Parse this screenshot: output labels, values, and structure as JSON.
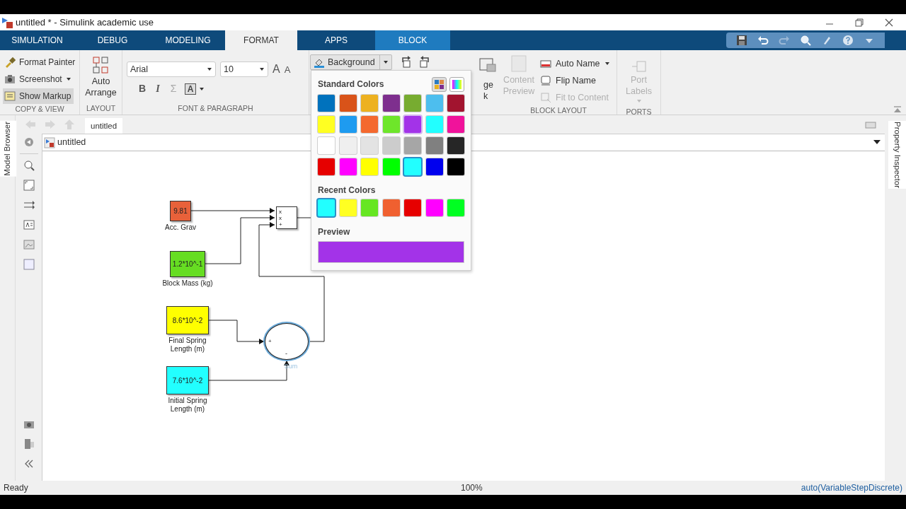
{
  "window": {
    "title": "untitled * - Simulink academic use"
  },
  "tabs": [
    {
      "label": "SIMULATION",
      "selected": false,
      "kind": "main"
    },
    {
      "label": "DEBUG",
      "selected": false,
      "kind": "main"
    },
    {
      "label": "MODELING",
      "selected": false,
      "kind": "main"
    },
    {
      "label": "FORMAT",
      "selected": true,
      "kind": "main"
    },
    {
      "label": "APPS",
      "selected": false,
      "kind": "main"
    },
    {
      "label": "BLOCK",
      "selected": false,
      "kind": "contextual"
    }
  ],
  "ribbon": {
    "copy_view": {
      "section": "COPY & VIEW",
      "items": [
        {
          "label": "Format Painter",
          "kind": "painter",
          "pressed": false,
          "has_menu": false
        },
        {
          "label": "Screenshot",
          "kind": "camera",
          "pressed": false,
          "has_menu": true
        },
        {
          "label": "Show Markup",
          "kind": "markup",
          "pressed": true,
          "has_menu": false
        }
      ]
    },
    "layout": {
      "section": "LAYOUT",
      "button": "Auto Arrange"
    },
    "font": {
      "section": "FONT & PARAGRAPH",
      "font_name": "Arial",
      "font_size": "10",
      "grow": "A",
      "shrink": "A",
      "styles": [
        {
          "label": "B",
          "kind": "bold"
        },
        {
          "label": "I",
          "kind": "italic"
        },
        {
          "label": "Σ",
          "kind": "symbol"
        }
      ],
      "text_color": "A"
    },
    "format": {
      "background": "Background"
    },
    "arrange_cut": {
      "lines": [
        "ge",
        "k"
      ]
    },
    "block_layout": {
      "section": "BLOCK LAYOUT",
      "content_preview": {
        "label": "Content Preview",
        "disabled": true
      },
      "items": [
        {
          "label": "Auto Name",
          "kind": "name",
          "disabled": false,
          "has_menu": true
        },
        {
          "label": "Flip Name",
          "kind": "flip",
          "disabled": false,
          "has_menu": false
        },
        {
          "label": "Fit to Content",
          "kind": "fit",
          "disabled": true,
          "has_menu": false
        }
      ]
    },
    "ports": {
      "section": "PORTS",
      "button": {
        "label": "Port Labels",
        "disabled": true,
        "has_menu": true
      }
    }
  },
  "explorer": {
    "left_tab": "Model Browser",
    "right_tab": "Property Inspector",
    "breadcrumb_tab": "untitled",
    "address": "untitled"
  },
  "diagram": {
    "blocks": [
      {
        "kind": "constant",
        "value": "9.81",
        "label": "Acc. Grav",
        "color": "#e8613a"
      },
      {
        "kind": "constant",
        "value": "1.2*10^-1",
        "label": "Block Mass (kg)",
        "color": "#66dd22"
      },
      {
        "kind": "constant",
        "value": "8.6*10^-2",
        "label": "Final Spring\nLength (m)",
        "color": "#ffff00"
      },
      {
        "kind": "constant",
        "value": "7.6*10^-2",
        "label": "Initial Spring\nLength (m)",
        "color": "#22ffff"
      },
      {
        "kind": "product",
        "signs": [
          "x",
          "x",
          "+"
        ]
      },
      {
        "kind": "sum",
        "signs": [
          "+",
          "-"
        ],
        "label": "Sum",
        "selected": true
      }
    ]
  },
  "color_picker": {
    "title": "Standard Colors",
    "standard": [
      {
        "color": "#0072bd",
        "selected": false,
        "hovered": false
      },
      {
        "color": "#d95319",
        "selected": false,
        "hovered": false
      },
      {
        "color": "#edb120",
        "selected": false,
        "hovered": false
      },
      {
        "color": "#7e2f8e",
        "selected": false,
        "hovered": false
      },
      {
        "color": "#77ac30",
        "selected": false,
        "hovered": false
      },
      {
        "color": "#4dbeee",
        "selected": false,
        "hovered": false
      },
      {
        "color": "#a2142f",
        "selected": false,
        "hovered": false
      },
      {
        "color": "#ffff22",
        "selected": false,
        "hovered": false
      },
      {
        "color": "#1e9bf0",
        "selected": false,
        "hovered": false
      },
      {
        "color": "#f4692f",
        "selected": false,
        "hovered": false
      },
      {
        "color": "#6ee62a",
        "selected": false,
        "hovered": false
      },
      {
        "color": "#a333e8",
        "selected": false,
        "hovered": true
      },
      {
        "color": "#22ffff",
        "selected": false,
        "hovered": false
      },
      {
        "color": "#f0139b",
        "selected": false,
        "hovered": false
      },
      {
        "color": "#ffffff",
        "selected": false,
        "hovered": false
      },
      {
        "color": "#efefef",
        "selected": false,
        "hovered": false
      },
      {
        "color": "#e3e3e3",
        "selected": false,
        "hovered": false
      },
      {
        "color": "#cccccc",
        "selected": false,
        "hovered": false
      },
      {
        "color": "#a6a6a6",
        "selected": false,
        "hovered": false
      },
      {
        "color": "#808080",
        "selected": false,
        "hovered": false
      },
      {
        "color": "#262626",
        "selected": false,
        "hovered": false
      },
      {
        "color": "#e60000",
        "selected": false,
        "hovered": false
      },
      {
        "color": "#ff00ff",
        "selected": false,
        "hovered": false
      },
      {
        "color": "#ffff00",
        "selected": false,
        "hovered": false
      },
      {
        "color": "#00ff00",
        "selected": false,
        "hovered": false
      },
      {
        "color": "#22ffff",
        "selected": true,
        "hovered": false
      },
      {
        "color": "#0000ee",
        "selected": false,
        "hovered": false
      },
      {
        "color": "#000000",
        "selected": false,
        "hovered": false
      }
    ],
    "recent_title": "Recent Colors",
    "recent": [
      {
        "color": "#22ffff",
        "selected": true
      },
      {
        "color": "#ffff22",
        "selected": false
      },
      {
        "color": "#66e622",
        "selected": false
      },
      {
        "color": "#f06030",
        "selected": false
      },
      {
        "color": "#e60000",
        "selected": false
      },
      {
        "color": "#ff00ff",
        "selected": false
      },
      {
        "color": "#00ff22",
        "selected": false
      }
    ],
    "preview_title": "Preview"
  },
  "status_bar": {
    "state": "Ready",
    "zoom": "100%",
    "solver": "auto(VariableStepDiscrete)"
  }
}
